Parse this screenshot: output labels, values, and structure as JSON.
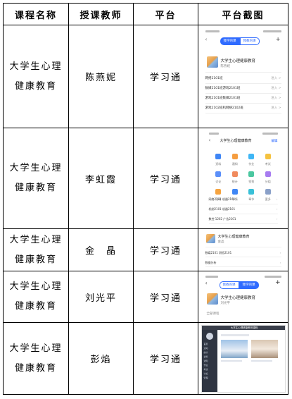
{
  "header": {
    "course": "课程名称",
    "teacher": "授课教师",
    "platform": "平台",
    "screenshot": "平台截图"
  },
  "rows": [
    {
      "course": "大学生心理健康教育",
      "teacher": "陈燕妮",
      "platform": "学习通"
    },
    {
      "course": "大学生心理健康教育",
      "teacher": "李虹霞",
      "platform": "学习通"
    },
    {
      "course": "大学生心理健康教育",
      "teacher": "金　晶",
      "platform": "学习通"
    },
    {
      "course": "大学生心理健康教育",
      "teacher": "刘光平",
      "platform": "学习通"
    },
    {
      "course": "大学生心理健康教育",
      "teacher": "彭焰",
      "platform": "学习通"
    }
  ],
  "shot1": {
    "tab_learn": "我学的课",
    "tab_teach": "我教的课",
    "course_title": "大学生心理健康教育",
    "course_sub": "陈燕妮",
    "classes": [
      "网络2101班",
      "数媒2101班游戏2101班",
      "游戏2101班数媒2101班",
      "游戏2102班机网络2102班"
    ],
    "class_status": "进入 >"
  },
  "shot2": {
    "title": "大学生心理健康教育",
    "edit": "编辑",
    "grid": [
      "资料",
      "通知",
      "作业",
      "考试",
      "讨论",
      "统计",
      "签到",
      "分组",
      "活动",
      "学情",
      "章节",
      "更多"
    ],
    "items": [
      "网络2101 机器2101",
      "机制2101 机器2101",
      "数控 1202 广告2101"
    ]
  },
  "shot3": {
    "course_title": "大学生心理健康教育",
    "course_sub": "金晶",
    "row1": "数媒2101 测验2101",
    "row2": "数据分析"
  },
  "shot4": {
    "tab_learn": "我教的课",
    "tab_teach": "我学的课",
    "course_title": "大学生心理健康教育",
    "course_sub": "刘光平",
    "footer": "全部课程"
  },
  "shot5": {
    "header": "大学生心理健康教育课程",
    "menu": [
      "首页",
      "活动",
      "统计",
      "资料",
      "通知",
      "作业",
      "考试",
      "讨论",
      "管理"
    ]
  },
  "colors": {
    "accent": "#2f6bff",
    "border": "#000000"
  }
}
